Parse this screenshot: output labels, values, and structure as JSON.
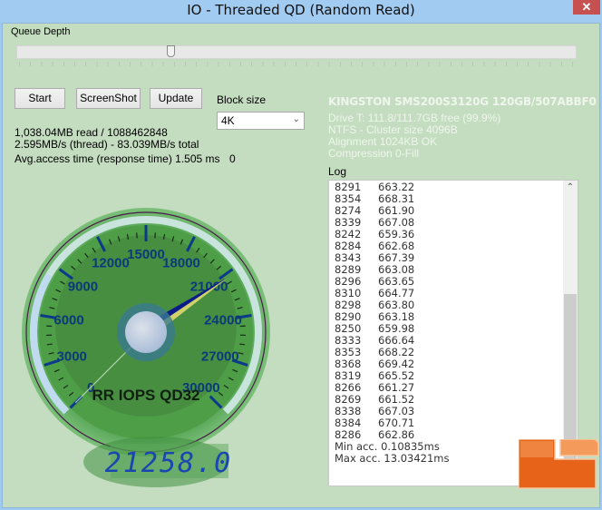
{
  "window": {
    "title": "IO - Threaded QD (Random Read)",
    "close_glyph": "✕"
  },
  "queue_depth": {
    "label": "Queue Depth",
    "slider_position_fraction": 0.25
  },
  "buttons": {
    "start": "Start",
    "screenshot": "ScreenShot",
    "update": "Update"
  },
  "block_size": {
    "label": "Block size",
    "selected": "4K",
    "arrow": "⌄"
  },
  "stats": {
    "read_line": "1,038.04MB read / 1088462848",
    "speed_line": "2.595MB/s (thread) - 83.039MB/s total",
    "access_line": "Avg.access time (response time) 1.505 ms",
    "counter": "0"
  },
  "drive": {
    "title": "KINGSTON SMS200S3120G 120GB/507ABBF0",
    "lines": [
      "Drive T: 111.8/111.7GB free (99.9%)",
      "NTFS - Cluster size 4096B",
      "Alignment 1024KB OK",
      "Compression 0-Fill"
    ]
  },
  "log": {
    "label": "Log",
    "rows": [
      [
        "8291",
        "663.22"
      ],
      [
        "8354",
        "668.31"
      ],
      [
        "8274",
        "661.90"
      ],
      [
        "8339",
        "667.08"
      ],
      [
        "8242",
        "659.36"
      ],
      [
        "8284",
        "662.68"
      ],
      [
        "8343",
        "667.39"
      ],
      [
        "8289",
        "663.08"
      ],
      [
        "8296",
        "663.65"
      ],
      [
        "8310",
        "664.77"
      ],
      [
        "8298",
        "663.80"
      ],
      [
        "8290",
        "663.18"
      ],
      [
        "8250",
        "659.98"
      ],
      [
        "8333",
        "666.64"
      ],
      [
        "8353",
        "668.22"
      ],
      [
        "8368",
        "669.42"
      ],
      [
        "8319",
        "665.52"
      ],
      [
        "8266",
        "661.27"
      ],
      [
        "8269",
        "661.52"
      ],
      [
        "8338",
        "667.03"
      ],
      [
        "8384",
        "670.71"
      ],
      [
        "8286",
        "662.86"
      ]
    ],
    "min_line": "Min acc. 0.10835ms",
    "max_line": "Max acc. 13.03421ms",
    "scroll_up": "⌃"
  },
  "gauge": {
    "title": "RR IOPS QD32",
    "min": 0,
    "max": 30000,
    "tick_labels": [
      "0",
      "3000",
      "6000",
      "9000",
      "12000",
      "15000",
      "18000",
      "21000",
      "24000",
      "27000",
      "30000"
    ],
    "value": 21258.0,
    "readout": "21258.0",
    "colors": {
      "face": "#4a9a44",
      "needle": "#0a1a8a",
      "needle_hl": "#e0d870",
      "tick": "#0b3a8a",
      "digits": "#1a46b0"
    }
  }
}
